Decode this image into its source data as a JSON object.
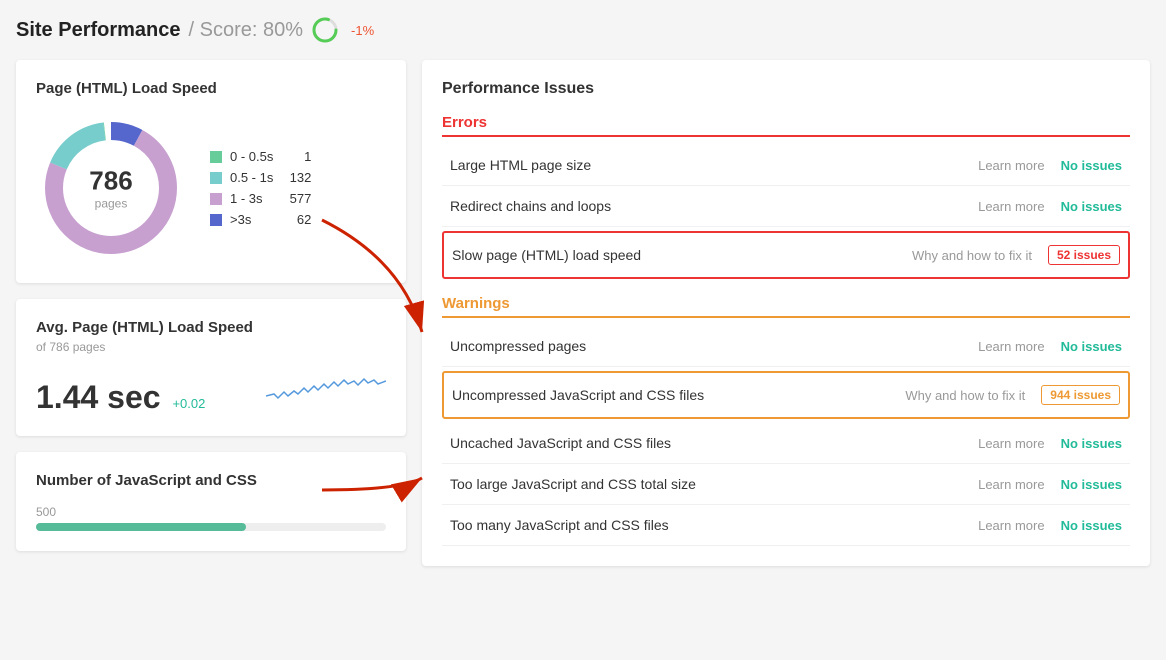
{
  "header": {
    "title": "Site Performance",
    "score_label": "/ Score: 80%",
    "score_delta": "-1%"
  },
  "left": {
    "load_speed_card": {
      "title": "Page (HTML) Load Speed",
      "donut": {
        "total": "786",
        "sublabel": "pages",
        "segments": [
          {
            "label": "0 - 0.5s",
            "value": 1,
            "color": "#6c9",
            "percent": 0.13
          },
          {
            "label": "0.5 - 1s",
            "value": 132,
            "color": "#7cc",
            "percent": 16.79
          },
          {
            "label": "1 - 3s",
            "value": 577,
            "color": "#c7a0d0",
            "percent": 73.41
          },
          {
            "label": ">3s",
            "value": 62,
            "color": "#5566cc",
            "percent": 7.89
          }
        ]
      }
    },
    "avg_speed_card": {
      "title": "Avg. Page (HTML) Load Speed",
      "subtitle": "of 786 pages",
      "value": "1.44 sec",
      "delta": "+0.02"
    },
    "js_card": {
      "title": "Number of JavaScript and CSS",
      "bar_label": "500"
    }
  },
  "right": {
    "title": "Performance Issues",
    "errors_label": "Errors",
    "warnings_label": "Warnings",
    "errors": [
      {
        "name": "Large HTML page size",
        "link": "Learn more",
        "status": "No issues",
        "status_type": "green",
        "highlighted": false
      },
      {
        "name": "Redirect chains and loops",
        "link": "Learn more",
        "status": "No issues",
        "status_type": "green",
        "highlighted": false
      },
      {
        "name": "Slow page (HTML) load speed",
        "link": "Why and how to fix it",
        "status": "52 issues",
        "status_type": "red",
        "highlighted": true
      }
    ],
    "warnings": [
      {
        "name": "Uncompressed pages",
        "link": "Learn more",
        "status": "No issues",
        "status_type": "green",
        "highlighted": false
      },
      {
        "name": "Uncompressed JavaScript and CSS files",
        "link": "Why and how to fix it",
        "status": "944 issues",
        "status_type": "orange",
        "highlighted": true
      },
      {
        "name": "Uncached JavaScript and CSS files",
        "link": "Learn more",
        "status": "No issues",
        "status_type": "green",
        "highlighted": false
      },
      {
        "name": "Too large JavaScript and CSS total size",
        "link": "Learn more",
        "status": "No issues",
        "status_type": "green",
        "highlighted": false
      },
      {
        "name": "Too many JavaScript and CSS files",
        "link": "Learn more",
        "status": "No issues",
        "status_type": "green",
        "highlighted": false
      }
    ]
  }
}
